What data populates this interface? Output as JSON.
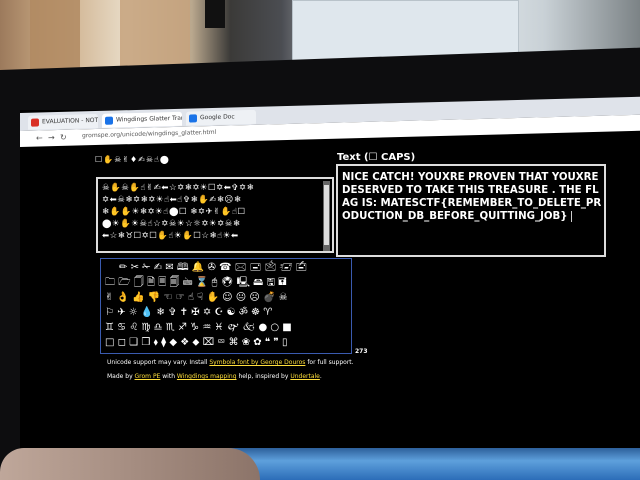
{
  "browser": {
    "tabs": [
      {
        "label": "EVALUATION - NOTIF",
        "color": "#d93025"
      },
      {
        "label": "Wingdings Glatter Tran",
        "color": "#1a73e8"
      },
      {
        "label": "Google Doc",
        "color": "#1a73e8"
      }
    ],
    "url": "gromspe.org/unicode/wingdings_glatter.html"
  },
  "page": {
    "glyph_label": "☐✋☠✌♦✍☠☝⬤",
    "text_label": "Text (☐ CAPS)",
    "input_lines": [
      "☠✋☠✋☝✌✍⬅☆✡❄✡☀☐✡⬅✞✡❄",
      "✡⬅☠❄✡❄✡☀☝⬅☝✞❄✋✍❄☹❄",
      "❄✋✋☀❄✡☀☝⬤☐ ❄✡✈✌✋☝☐",
      "⬤☀✋☀☠☝☆✡☠☀☆☼✡☀✡☠❄",
      "⬅☆❄♉☐✡☐✋☝☀✋☐☆❄☝☀⬅"
    ],
    "output_text": "NICE CATCH! YOUXRE PROVEN THAT YOUXRE DESERVED TO TAKE THIS TREASURE . THE FLAG IS: MATESCTF{REMEMBER_TO_DELETE_PRODUCTION_DB_BEFORE_QUITTING_JOB}",
    "keyboard_rows": [
      "✏✂✁✍✉🕮🔔✇☎🖂🖃🖄🖅🖆",
      "🗀🗁🗍🗎🗏🗐🖮⌛🖰🖲🖳🖴🖫🖬",
      "✌👌👍👎☜☞☝☟✋☺😐☹💣☠",
      "⚐✈☼💧❄✞✝✠✡☪☯ॐ☸♈",
      "♊♋♌♍♎♏♐♑♒♓🙰🙵●○■",
      "□◻❑❒⬧⧫◆❖⬥⌧⮹⌘❀✿❝❞▯"
    ],
    "char_count": "273",
    "info_line1_prefix": "Unicode support may vary. Install ",
    "info_line1_link": "Symbola font by George Douros",
    "info_line1_suffix": " for full support.",
    "info_line2_prefix": "Made by ",
    "info_line2_link1": "Grom PE",
    "info_line2_mid": " with ",
    "info_line2_link2": "Wingdings mapping",
    "info_line2_mid2": " help, inspired by ",
    "info_line2_link3": "Undertale",
    "info_line2_suffix": "."
  }
}
